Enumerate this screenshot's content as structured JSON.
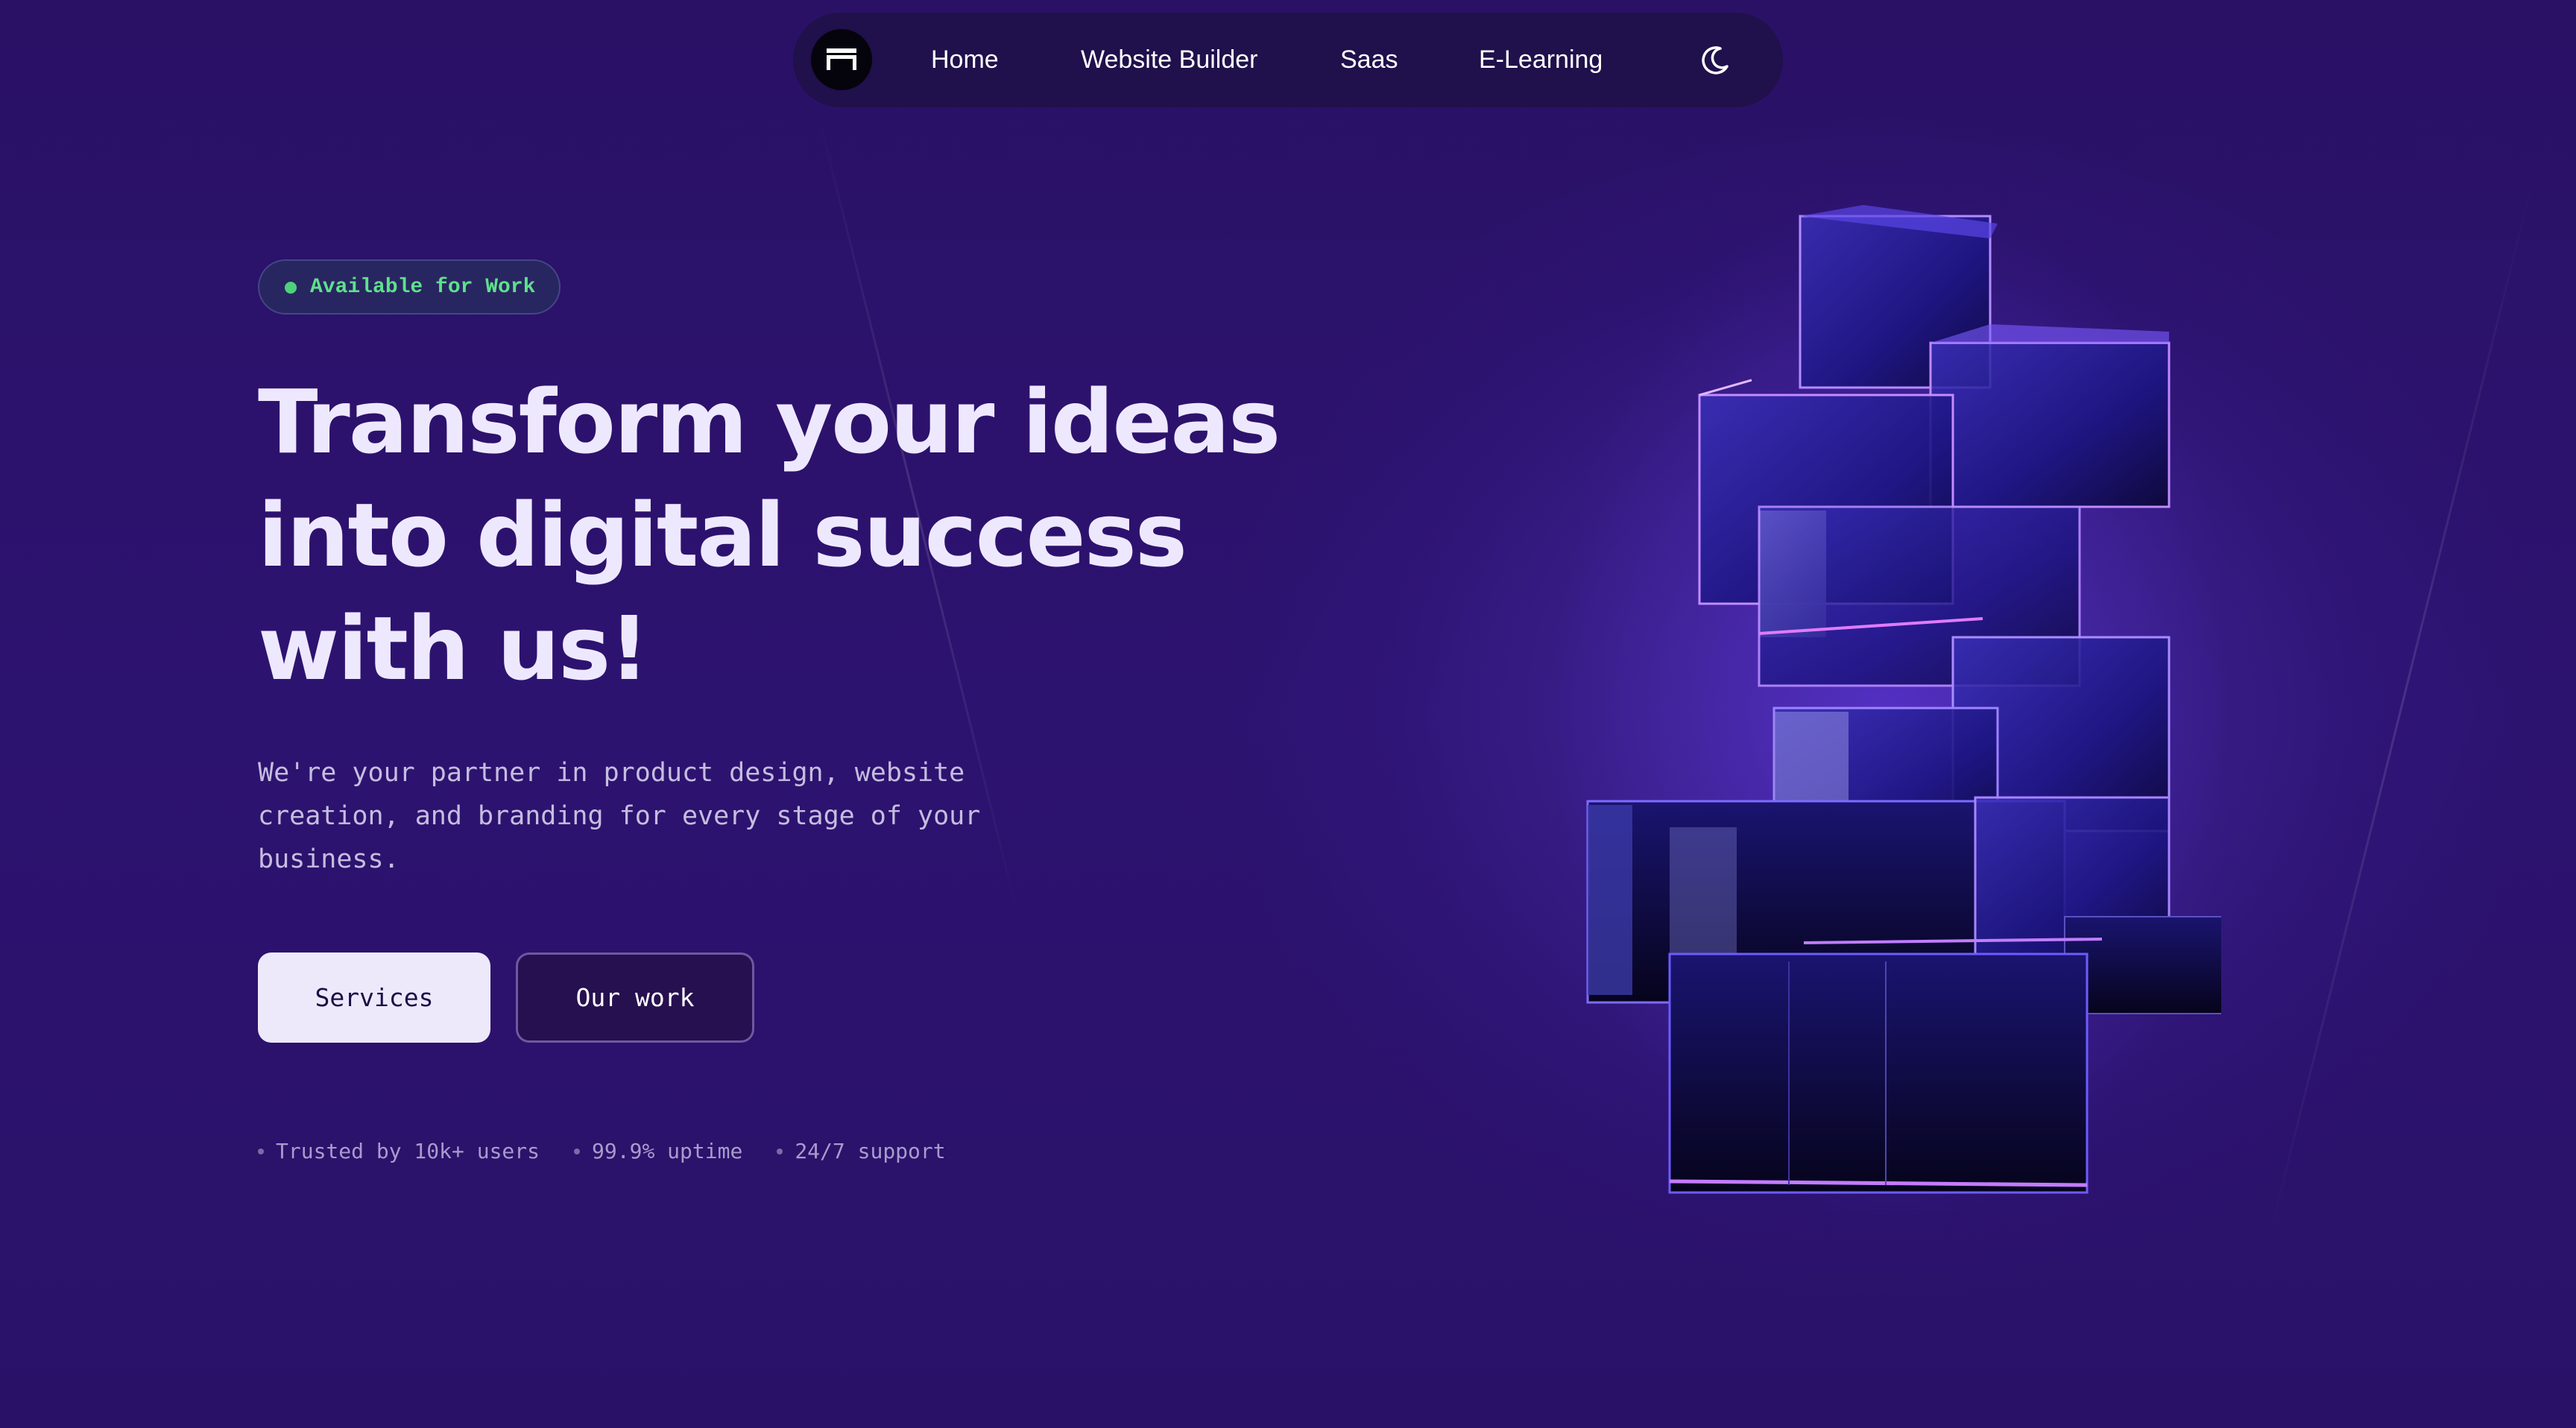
{
  "nav": {
    "logo": "site-logo",
    "links": [
      "Home",
      "Website Builder",
      "Saas",
      "E-Learning"
    ],
    "theme_icon": "moon-icon"
  },
  "hero": {
    "badge": "Available for Work",
    "headline_lines": [
      "Transform your ideas",
      "into digital success",
      "with us!"
    ],
    "subtext": "We're your partner in product design, website creation, and branding for every stage of your business.",
    "primary_button": "Services",
    "secondary_button": "Our work",
    "stats": [
      "Trusted by 10k+ users",
      "99.9% uptime",
      "24/7 support"
    ]
  },
  "colors": {
    "background": "#2a1166",
    "accent_green": "#5fe08c",
    "headline": "#eee8ff",
    "cube_glow": "#8a4dff"
  },
  "illustration": "glass-cube-stack"
}
